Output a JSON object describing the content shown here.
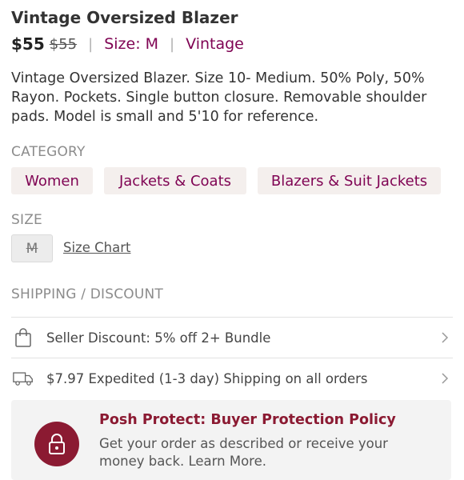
{
  "listing": {
    "title": "Vintage Oversized Blazer",
    "price": "$55",
    "original_price": "$55",
    "size_label": "Size: M",
    "tag": "Vintage",
    "description": "Vintage Oversized Blazer. Size 10- Medium. 50% Poly, 50% Rayon. Pockets. Single button closure. Removable shoulder pads. Model is small and 5'10 for reference."
  },
  "category": {
    "heading": "CATEGORY",
    "chips": [
      "Women",
      "Jackets & Coats",
      "Blazers & Suit Jackets"
    ]
  },
  "size": {
    "heading": "SIZE",
    "value": "M",
    "chart_link": "Size Chart"
  },
  "shipping": {
    "heading": "SHIPPING / DISCOUNT",
    "rows": [
      {
        "icon": "shopping-bag-icon",
        "text": "Seller Discount: 5% off 2+ Bundle"
      },
      {
        "icon": "truck-icon",
        "text": "$7.97 Expedited (1-3 day) Shipping on all orders"
      }
    ]
  },
  "protect": {
    "icon": "shield-lock-icon",
    "title": "Posh Protect: Buyer Protection Policy",
    "subtitle": "Get your order as described or receive your money back. Learn More."
  },
  "colors": {
    "accent": "#7f0353",
    "protect_red": "#8b1a32",
    "chip_bg": "#f4efed"
  }
}
